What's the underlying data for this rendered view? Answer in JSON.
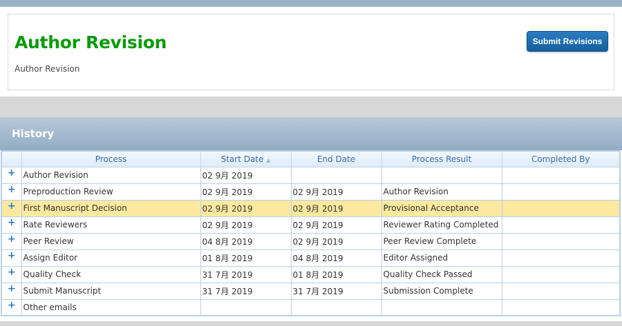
{
  "header": {
    "title": "Author Revision",
    "subtitle": "Author Revision",
    "submit_label": "Submit Revisions"
  },
  "history": {
    "title": "History",
    "columns": [
      "Process",
      "Start Date",
      "End Date",
      "Process Result",
      "Completed By"
    ],
    "sort_icon": "▲",
    "rows": [
      {
        "process": "Author Revision",
        "start": "02 9月 2019",
        "end": "",
        "result": "",
        "by": ""
      },
      {
        "process": "Preproduction Review",
        "start": "02 9月 2019",
        "end": "02 9月 2019",
        "result": "Author Revision",
        "by": ""
      },
      {
        "process": "First Manuscript Decision",
        "start": "02 9月 2019",
        "end": "02 9月 2019",
        "result": "Provisional Acceptance",
        "by": ""
      },
      {
        "process": "Rate Reviewers",
        "start": "02 9月 2019",
        "end": "02 9月 2019",
        "result": "Reviewer Rating Completed",
        "by": ""
      },
      {
        "process": "Peer Review",
        "start": "04 8月 2019",
        "end": "02 9月 2019",
        "result": "Peer Review Complete",
        "by": ""
      },
      {
        "process": "Assign Editor",
        "start": "01 8月 2019",
        "end": "04 8月 2019",
        "result": "Editor Assigned",
        "by": ""
      },
      {
        "process": "Quality Check",
        "start": "31 7月 2019",
        "end": "01 8月 2019",
        "result": "Quality Check Passed",
        "by": ""
      },
      {
        "process": "Submit Manuscript",
        "start": "31 7月 2019",
        "end": "31 7月 2019",
        "result": "Submission Complete",
        "by": ""
      },
      {
        "process": "Other emails",
        "start": "",
        "end": "",
        "result": "",
        "by": ""
      }
    ],
    "expand_icon": "+",
    "highlight_row": 2,
    "highlight_color": "#fbe9a0"
  }
}
